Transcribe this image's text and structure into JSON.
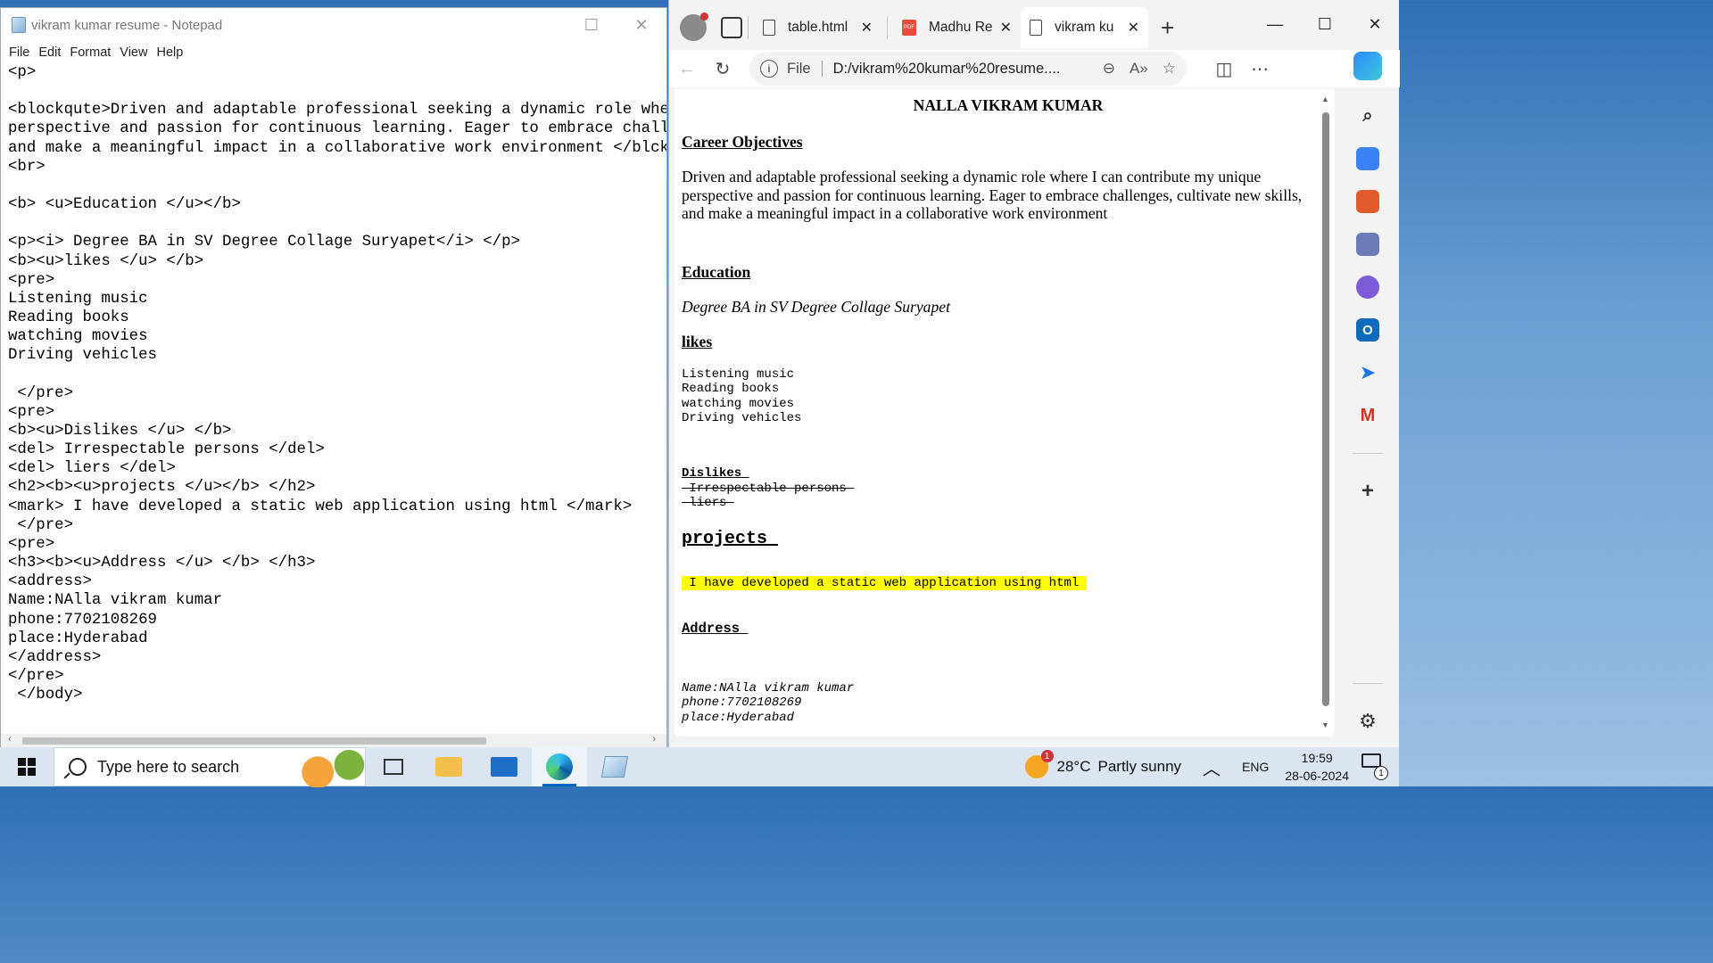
{
  "notepad": {
    "title": "vikram kumar resume - Notepad",
    "menu": [
      "File",
      "Edit",
      "Format",
      "View",
      "Help"
    ],
    "content": "<p>\n\n<blockqute>Driven and adaptable professional seeking a dynamic role where I\nperspective and passion for continuous learning. Eager to embrace challenge\nand make a meaningful impact in a collaborative work environment </blckqute\n<br>\n\n<b> <u>Education </u></b>\n\n<p><i> Degree BA in SV Degree Collage Suryapet</i> </p>\n<b><u>likes </u> </b>\n<pre>\nListening music\nReading books\nwatching movies\nDriving vehicles\n\n </pre>\n<pre>\n<b><u>Dislikes </u> </b>\n<del> Irrespectable persons </del>\n<del> liers </del>\n<h2><b><u>projects </u></b> </h2>\n<mark> I have developed a static web application using html </mark>\n </pre>\n<pre>\n<h3><b><u>Address </u> </b> </h3>\n<address>\nName:NAlla vikram kumar\nphone:7702108269\nplace:Hyderabad\n</address>\n</pre>\n </body>"
  },
  "browser": {
    "tabs": [
      {
        "label": "table.html",
        "icon": "doc-icon"
      },
      {
        "label": "Madhu Re",
        "icon": "pdf-icon"
      },
      {
        "label": "vikram ku",
        "icon": "doc-icon",
        "active": true
      }
    ],
    "address": {
      "scheme": "File",
      "url": "D:/vikram%20kumar%20resume...."
    }
  },
  "resume": {
    "name": "NALLA VIKRAM KUMAR",
    "career_heading": "Career Objectives",
    "objective": "Driven and adaptable professional seeking a dynamic role where I can contribute my unique perspective and passion for continuous learning. Eager to embrace challenges, cultivate new skills, and make a meaningful impact in a collaborative work environment",
    "education_heading": "Education",
    "degree": "Degree BA in SV Degree Collage Suryapet",
    "likes_heading": "likes",
    "likes": "Listening music\nReading books\nwatching movies\nDriving vehicles",
    "dislikes_heading": "Dislikes ",
    "dislike_1": " Irrespectable persons ",
    "dislike_2": " liers ",
    "projects_heading": "projects ",
    "project_text": " I have developed a static web application using html ",
    "address_heading": "Address ",
    "address": "Name:NAlla vikram kumar\nphone:7702108269\nplace:Hyderabad"
  },
  "taskbar": {
    "search_placeholder": "Type here to search",
    "weather_temp": "28°C",
    "weather_desc": "Partly sunny",
    "weather_badge": "1",
    "language": "ENG",
    "time": "19:59",
    "date": "28-06-2024",
    "notifications": "1"
  }
}
